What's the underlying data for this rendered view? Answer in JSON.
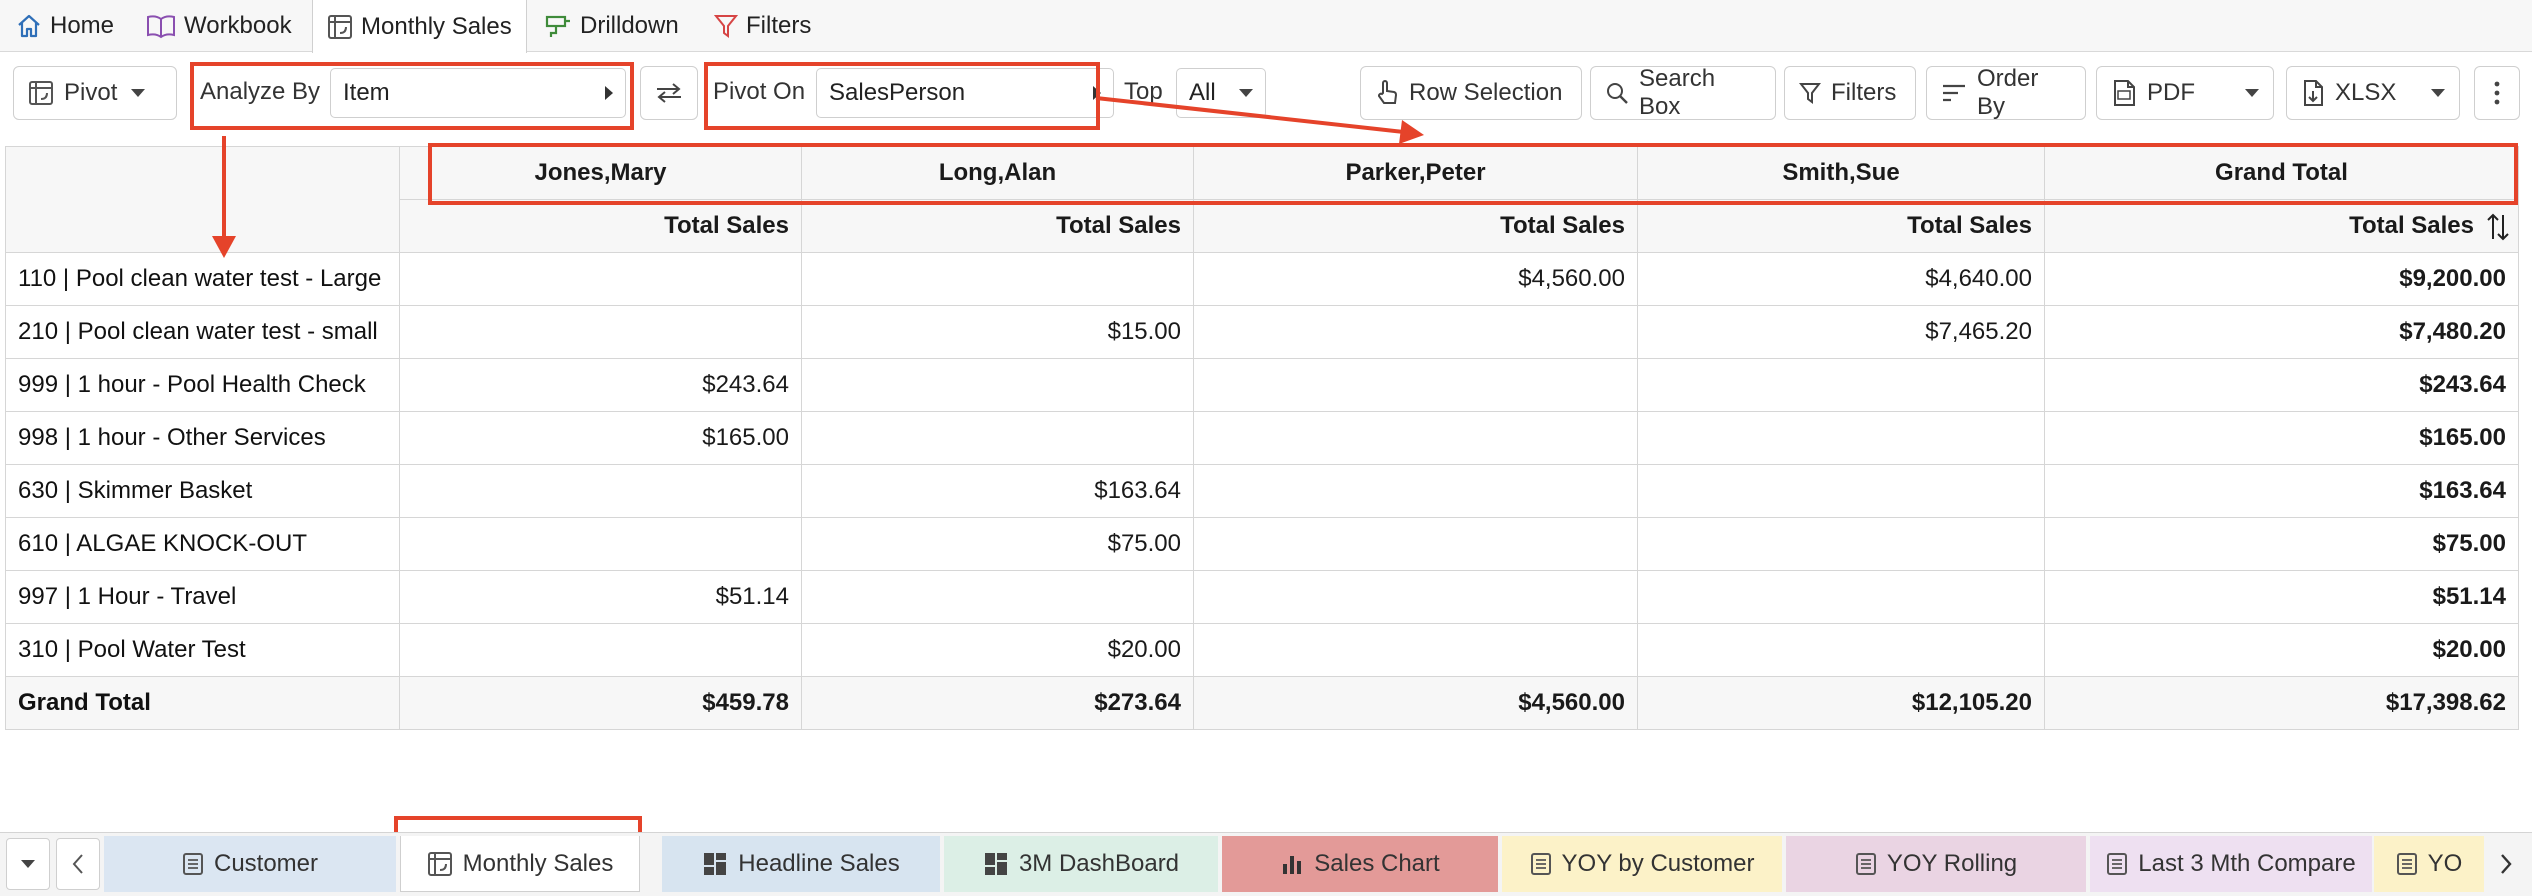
{
  "nav": {
    "tabs": [
      {
        "label": "Home",
        "icon": "home-icon"
      },
      {
        "label": "Workbook",
        "icon": "book-icon"
      },
      {
        "label": "Monthly Sales",
        "icon": "pivot-icon",
        "active": true
      },
      {
        "label": "Drilldown",
        "icon": "drilldown-icon"
      },
      {
        "label": "Filters",
        "icon": "filter-icon"
      }
    ]
  },
  "toolbar": {
    "pivot_label": "Pivot",
    "analyze_by_label": "Analyze By",
    "analyze_by_value": "Item",
    "pivot_on_label": "Pivot On",
    "pivot_on_value": "SalesPerson",
    "top_label": "Top",
    "top_value": "All",
    "row_selection_label": "Row Selection",
    "search_box_label": "Search Box",
    "filters_label": "Filters",
    "order_by_label": "Order By",
    "pdf_label": "PDF",
    "xlsx_label": "XLSX"
  },
  "grid": {
    "columns": [
      "Jones,Mary",
      "Long,Alan",
      "Parker,Peter",
      "Smith,Sue",
      "Grand Total"
    ],
    "measure": "Total Sales",
    "rows": [
      {
        "label": "110 | Pool clean water test - Large",
        "values": [
          "",
          "",
          "$4,560.00",
          "$4,640.00"
        ],
        "total": "$9,200.00"
      },
      {
        "label": "210 | Pool clean water test - small",
        "values": [
          "",
          "$15.00",
          "",
          "$7,465.20"
        ],
        "total": "$7,480.20"
      },
      {
        "label": "999 | 1 hour - Pool Health Check",
        "values": [
          "$243.64",
          "",
          "",
          ""
        ],
        "total": "$243.64"
      },
      {
        "label": "998 | 1 hour - Other Services",
        "values": [
          "$165.00",
          "",
          "",
          ""
        ],
        "total": "$165.00"
      },
      {
        "label": "630 | Skimmer Basket",
        "values": [
          "",
          "$163.64",
          "",
          ""
        ],
        "total": "$163.64"
      },
      {
        "label": "610 | ALGAE KNOCK-OUT",
        "values": [
          "",
          "$75.00",
          "",
          ""
        ],
        "total": "$75.00"
      },
      {
        "label": "997 | 1 Hour - Travel",
        "values": [
          "$51.14",
          "",
          "",
          ""
        ],
        "total": "$51.14"
      },
      {
        "label": "310 | Pool Water Test",
        "values": [
          "",
          "$20.00",
          "",
          ""
        ],
        "total": "$20.00"
      }
    ],
    "grand_total": {
      "label": "Grand Total",
      "values": [
        "$459.78",
        "$273.64",
        "$4,560.00",
        "$12,105.20"
      ],
      "total": "$17,398.62"
    }
  },
  "sheets": {
    "tabs": [
      {
        "label": "Customer",
        "color": "#dbe6f2",
        "icon": "list-icon"
      },
      {
        "label": "Monthly Sales",
        "color": "#ffffff",
        "icon": "pivot-icon",
        "active": true
      },
      {
        "label": "Headline Sales",
        "color": "#d7e4f0",
        "icon": "dashboard-icon"
      },
      {
        "label": "3M DashBoard",
        "color": "#dcefe6",
        "icon": "dashboard-icon"
      },
      {
        "label": "Sales Chart",
        "color": "#e39a98",
        "icon": "bar-chart-icon"
      },
      {
        "label": "YOY by Customer",
        "color": "#fcf2c8",
        "icon": "list-icon"
      },
      {
        "label": "YOY Rolling",
        "color": "#ead4e3",
        "icon": "list-icon"
      },
      {
        "label": "Last 3 Mth Compare",
        "color": "#eee0f1",
        "icon": "list-icon"
      },
      {
        "label": "YO",
        "color": "#fcf2c8",
        "icon": "list-icon"
      }
    ]
  },
  "colors": {
    "annotation": "#e5432a",
    "accent_blue": "#2f6fb8",
    "accent_green": "#3f8b3a",
    "accent_purple": "#8a4fb0",
    "accent_red": "#d64545"
  }
}
